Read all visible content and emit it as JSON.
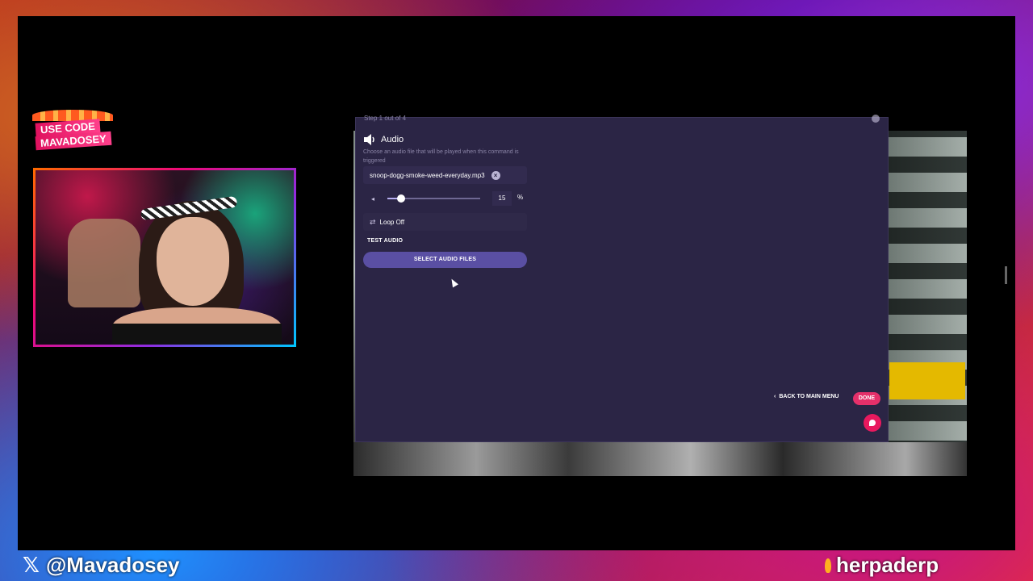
{
  "promo": {
    "line1": "USE CODE",
    "line2": "MAVADOSEY"
  },
  "modal": {
    "step_label": "Step 1 out of 4",
    "audio_title": "Audio",
    "audio_description": "Choose an audio file that will be played when this command is triggered",
    "file_name": "snoop-dogg-smoke-weed-everyday.mp3",
    "remove_icon": "×",
    "volume": {
      "value": "15",
      "unit": "%",
      "level": 0.15
    },
    "loop_label": "Loop Off",
    "test_audio_label": "TEST AUDIO",
    "select_button": "SELECT AUDIO FILES",
    "back_button": "BACK TO MAIN MENU",
    "done_button": "DONE"
  },
  "overlay": {
    "x_logo": "𝕏",
    "handle": "@Mavadosey",
    "tag": "herpaderp"
  },
  "colors": {
    "modal_bg": "#2b2545",
    "select_btn": "#5a4fa3",
    "done_btn": "#e5306a",
    "fab": "#e8195e"
  }
}
